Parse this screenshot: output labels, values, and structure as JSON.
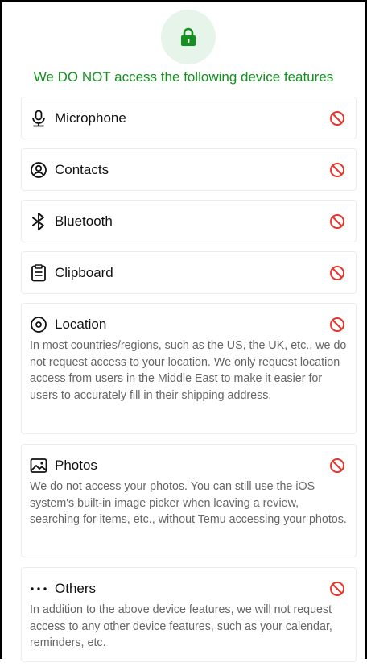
{
  "header": {
    "icon": "lock-icon",
    "accent_color": "#14921f",
    "title": "We DO NOT access the following device features"
  },
  "features": [
    {
      "icon": "microphone-icon",
      "title": "Microphone",
      "status_icon": "blocked-icon"
    },
    {
      "icon": "contacts-icon",
      "title": "Contacts",
      "status_icon": "blocked-icon"
    },
    {
      "icon": "bluetooth-icon",
      "title": "Bluetooth",
      "status_icon": "blocked-icon"
    },
    {
      "icon": "clipboard-icon",
      "title": "Clipboard",
      "status_icon": "blocked-icon"
    },
    {
      "icon": "location-icon",
      "title": "Location",
      "status_icon": "blocked-icon",
      "description": "In most countries/regions, such as the US, the UK, etc., we do not request access to your location. We only request location access from users in the Middle East to make it easier for users to accurately fill in their shipping address."
    },
    {
      "icon": "photos-icon",
      "title": "Photos",
      "status_icon": "blocked-icon",
      "description": "We do not access your photos. You can still use the iOS system's built-in image picker when leaving a review, searching for items, etc., without Temu accessing your photos."
    },
    {
      "icon": "more-icon",
      "title": "Others",
      "status_icon": "blocked-icon",
      "description": "In addition to the above device features, we will not request access to any other device features, such as your calendar, reminders, etc."
    }
  ],
  "colors": {
    "blocked": "#e8362b",
    "badge_bg": "#e7f4ea"
  }
}
